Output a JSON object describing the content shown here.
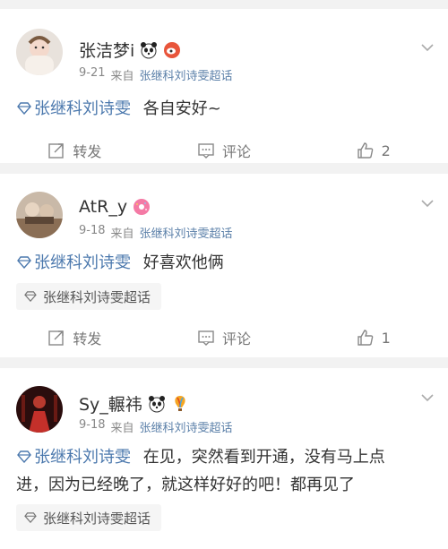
{
  "posts": [
    {
      "username": "张洁梦i",
      "time": "9-21",
      "source_prefix": "来自",
      "source": "张继科刘诗雯超话",
      "topic": "张继科刘诗雯",
      "text": "各自安好~",
      "chip": "",
      "repost_label": "转发",
      "comment_label": "评论",
      "like_count": "2",
      "badges": [
        "panda-icon",
        "weibo-icon"
      ]
    },
    {
      "username": "AtR_y",
      "time": "9-18",
      "source_prefix": "来自",
      "source": "张继科刘诗雯超话",
      "topic": "张继科刘诗雯",
      "text": "好喜欢他俩",
      "chip": "张继科刘诗雯超话",
      "repost_label": "转发",
      "comment_label": "评论",
      "like_count": "1",
      "badges": [
        "donut-icon"
      ]
    },
    {
      "username": "Sy_輾祎",
      "time": "9-18",
      "source_prefix": "来自",
      "source": "张继科刘诗雯超话",
      "topic": "张继科刘诗雯",
      "text": "在见，突然看到开通，没有马上点",
      "text2": "进，因为已经晚了，就这样好好的吧！都再见了",
      "chip": "张继科刘诗雯超话",
      "badges": [
        "panda-icon",
        "balloon-icon"
      ]
    }
  ],
  "colors": {
    "link": "#4b78ad",
    "source": "#5a7fa8",
    "meta": "#888888"
  }
}
